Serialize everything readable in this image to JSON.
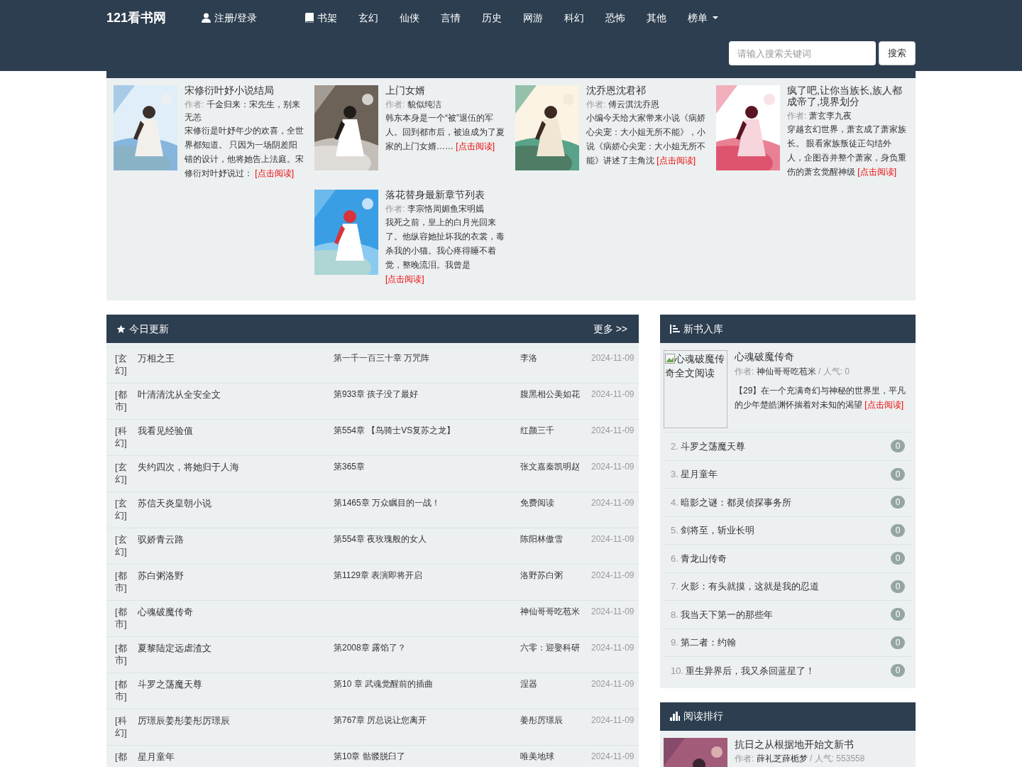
{
  "header": {
    "brand": "121看书网",
    "nav": [
      {
        "kind": "account",
        "label": "注册/登录"
      },
      {
        "kind": "shelf",
        "label": "书架"
      },
      {
        "kind": "category",
        "label": "玄幻"
      },
      {
        "kind": "category",
        "label": "仙侠"
      },
      {
        "kind": "category",
        "label": "言情"
      },
      {
        "kind": "category",
        "label": "历史"
      },
      {
        "kind": "category",
        "label": "网游"
      },
      {
        "kind": "category",
        "label": "科幻"
      },
      {
        "kind": "category",
        "label": "恐怖"
      },
      {
        "kind": "category",
        "label": "其他"
      },
      {
        "kind": "dropdown",
        "label": "榜单"
      }
    ],
    "search": {
      "placeholder": "请输入搜索关键词",
      "button": "搜索"
    }
  },
  "featured": [
    {
      "title": "宋修衍叶妤小说结局",
      "author_label": "作者:",
      "author": "千金归来：宋先生，别来无恙",
      "summary": "宋修衍是叶妤年少的欢喜，全世界都知道。 只因为一场阴差阳错的设计，他将她告上法庭。宋修衍对叶妤说过：",
      "link": "[点击阅读]"
    },
    {
      "title": "上门女婿",
      "author_label": "作者:",
      "author": "貌似纯洁",
      "summary": "韩东本身是一个“被”退伍的军人。回到都市后，被迫成为了夏家的上门女婿……",
      "link": "[点击阅读]"
    },
    {
      "title": "沈乔恩沈君祁",
      "author_label": "作者:",
      "author": "傅云淇沈乔恩",
      "summary": "小编今天给大家带来小说《病娇心尖宠：大小姐无所不能》，小说《病娇心尖宠：大小姐无所不能》讲述了主角沈",
      "link": "[点击阅读]"
    },
    {
      "title": "疯了吧,让你当族长,族人都成帝了,境界划分",
      "author_label": "作者:",
      "author": "萧玄李九夜",
      "summary": "穿越玄幻世界，萧玄成了萧家族长。 眼看家族叛徒正勾结外人，企图吞并整个萧家，身负重伤的萧玄觉醒神级",
      "link": "[点击阅读]"
    },
    {
      "title": "落花替身最新章节列表",
      "author_label": "作者:",
      "author": "李宗恪周媚鱼宋明嫣",
      "summary": "我死之前，皇上的白月光回来了。他纵容她扯坏我的衣裳，毒杀我的小猫。我心疼得睡不着觉，整晚流泪。我曾是",
      "link": "[点击阅读]"
    }
  ],
  "today": {
    "title": "今日更新",
    "more": "更多 >>",
    "rows": [
      {
        "category": "[玄幻]",
        "title": "万相之王",
        "chapter": "第一千一百三十章 万咒阵",
        "author": "李洛",
        "date": "2024-11-09"
      },
      {
        "category": "[都市]",
        "title": "叶清清沈从全安全文",
        "chapter": "第933章 孩子没了最好",
        "author": "腹黑相公美如花",
        "date": "2024-11-09"
      },
      {
        "category": "[科幻]",
        "title": "我看见经验值",
        "chapter": "第554章 【鸟骑士VS复苏之龙】",
        "author": "红颜三千",
        "date": "2024-11-09"
      },
      {
        "category": "[玄幻]",
        "title": "失约四次，将她归于人海",
        "chapter": "第365章",
        "author": "张文嘉秦凯明赵",
        "date": "2024-11-09"
      },
      {
        "category": "[玄幻]",
        "title": "苏信天炎皇朝小说",
        "chapter": "第1465章 万众瞩目的一战！",
        "author": "免费阅读",
        "date": "2024-11-09"
      },
      {
        "category": "[玄幻]",
        "title": "驭娇青云路",
        "chapter": "第554章 夜玫瑰般的女人",
        "author": "陈阳林傲雪",
        "date": "2024-11-09"
      },
      {
        "category": "[都市]",
        "title": "苏白粥洛野",
        "chapter": "第1129章 表演即将开启",
        "author": "洛野苏白粥",
        "date": "2024-11-09"
      },
      {
        "category": "[都市]",
        "title": "心魂破魔传奇",
        "author": "神仙哥哥吃苞米",
        "date": "2024-11-09"
      },
      {
        "category": "[都市]",
        "title": "夏黎陆定远虐渣文",
        "chapter": "第2008章 露馅了？",
        "author": "六零：迎娶科研",
        "date": "2024-11-09"
      },
      {
        "category": "[都市]",
        "title": "斗罗之荡魔天尊",
        "chapter": "第10 章 武魂觉醒前的插曲",
        "author": "涅器",
        "date": "2024-11-09"
      },
      {
        "category": "[科幻]",
        "title": "厉璟辰姜彤姜彤厉璟辰",
        "chapter": "第767章 厉总说让您离开",
        "author": "姜彤厉璟辰",
        "date": "2024-11-09"
      },
      {
        "category": "[都",
        "title": "星月童年",
        "chapter": "第10章 骷髅脱臼了",
        "author": "唯美地球",
        "date": "2024-11-09"
      }
    ]
  },
  "new_books": {
    "title": "新书入库",
    "top": {
      "image_alt": "心魂破魔传奇全文阅读",
      "title": "心魂破魔传奇",
      "author_label": "作者:",
      "author": "神仙哥哥吃苞米",
      "popularity": "/ 人气: 0",
      "summary": "【29】在一个充满奇幻与神秘的世界里，平凡的少年楚皓渊怀揣着对未知的渴望",
      "link": "[点击阅读]"
    },
    "items": [
      {
        "rank": "2.",
        "title": "斗罗之荡魔天尊",
        "count": "0"
      },
      {
        "rank": "3.",
        "title": "星月童年",
        "count": "0"
      },
      {
        "rank": "4.",
        "title": "暗影之谜：都灵侦探事务所",
        "count": "0"
      },
      {
        "rank": "5.",
        "title": "剑将至，斩业长明",
        "count": "0"
      },
      {
        "rank": "6.",
        "title": "青龙山传奇",
        "count": "0"
      },
      {
        "rank": "7.",
        "title": "火影：有头就摸，这就是我的忍道",
        "count": "0"
      },
      {
        "rank": "8.",
        "title": "我当天下第一的那些年",
        "count": "0"
      },
      {
        "rank": "9.",
        "title": "第二者：约翰",
        "count": "0"
      },
      {
        "rank": "10.",
        "title": "重生异界后，我又杀回蓝星了！",
        "count": "0"
      }
    ]
  },
  "ranking": {
    "title": "阅读排行",
    "top": {
      "title": "抗日之从根据地开始文新书",
      "author_label": "作者:",
      "author": "薛礼芝薛栀梦",
      "popularity": "/ 人气: 553558"
    }
  }
}
